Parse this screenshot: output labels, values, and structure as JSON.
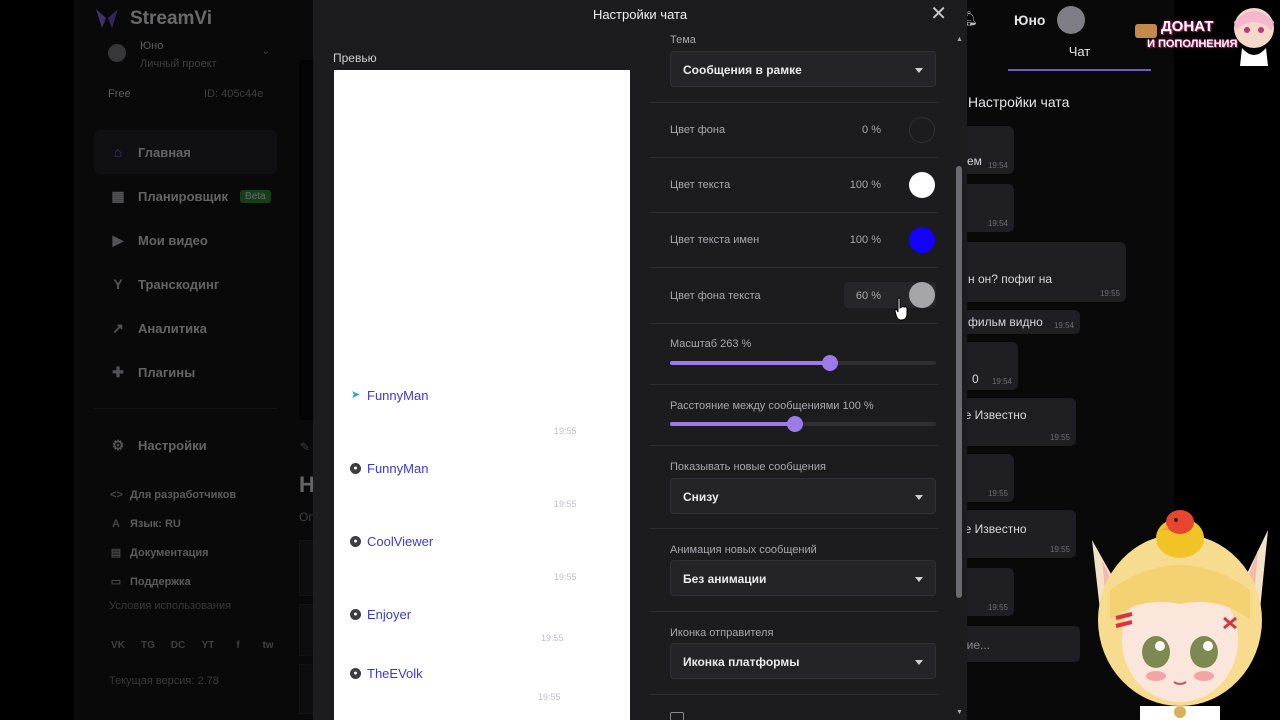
{
  "app": {
    "logo_text": "StreamVi",
    "project_name": "Юно",
    "project_sub": "Личный проект",
    "plan": "Free",
    "plan_id": "ID: 405c44e",
    "nav": [
      {
        "label": "Главная",
        "icon": "home-icon",
        "glyph": "⌂",
        "active": true
      },
      {
        "label": "Планировщик",
        "icon": "calendar-icon",
        "glyph": "▦",
        "badge": "Beta"
      },
      {
        "label": "Мои видео",
        "icon": "video-icon",
        "glyph": "▶"
      },
      {
        "label": "Транскодинг",
        "icon": "transcode-icon",
        "glyph": "Y"
      },
      {
        "label": "Аналитика",
        "icon": "analytics-icon",
        "glyph": "↗"
      },
      {
        "label": "Плагины",
        "icon": "puzzle-icon",
        "glyph": "✚"
      }
    ],
    "settings_label": "Настройки",
    "sublinks": [
      {
        "label": "Для разработчиков",
        "glyph": "<>"
      },
      {
        "label": "Язык: RU",
        "glyph": "A"
      },
      {
        "label": "Документация",
        "glyph": "▤"
      },
      {
        "label": "Поддержка",
        "glyph": "▭"
      }
    ],
    "terms": "Условия использования",
    "socials": [
      "VK",
      "TG",
      "DC",
      "YT",
      "f",
      "tw"
    ],
    "version": "Текущая версия: 2.78",
    "main_heading": "Н",
    "main_sub": "Оп",
    "user_name": "Юно",
    "chat_tab": "Чат",
    "chat_title": "Настройки чата",
    "chat_bubbles": [
      {
        "text": "ем",
        "time": "19:54"
      },
      {
        "text": "",
        "time": "19:54"
      },
      {
        "text": "н он? пофиг на",
        "time": "19:55"
      },
      {
        "text": "е фильм видно",
        "time": "19:54"
      },
      {
        "text": "0",
        "time": "19:54"
      },
      {
        "text": "ое Известно",
        "time": "19:55"
      },
      {
        "text": "",
        "time": "19:55"
      },
      {
        "text": "ое Известно",
        "time": "19:55"
      },
      {
        "text": "",
        "time": "19:55"
      },
      {
        "text": "ние...",
        "time": ""
      }
    ]
  },
  "modal": {
    "title": "Настройки чата",
    "preview_label": "Превью",
    "preview_messages": [
      {
        "name": "FunnyMan",
        "platform": "telegram",
        "time": "19:55"
      },
      {
        "name": "FunnyMan",
        "platform": "streamvi",
        "time": "19:55"
      },
      {
        "name": "CoolViewer",
        "platform": "streamvi",
        "time": "19:55"
      },
      {
        "name": "Enjoyer",
        "platform": "streamvi",
        "time": "19:55"
      },
      {
        "name": "TheEVolk",
        "platform": "streamvi",
        "time": "19:55"
      }
    ],
    "theme": {
      "label": "Тема",
      "value": "Сообщения в рамке"
    },
    "colors": [
      {
        "label": "Цвет фона",
        "percent": "0 %",
        "color": "#1c1c1f"
      },
      {
        "label": "Цвет текста",
        "percent": "100 %",
        "color": "#ffffff"
      },
      {
        "label": "Цвет текста имен",
        "percent": "100 %",
        "color": "#1400ff"
      },
      {
        "label": "Цвет фона текста",
        "percent": "60 %",
        "color": "#a6a6aa"
      }
    ],
    "scale": {
      "label": "Масштаб 263 %",
      "fraction": 0.6
    },
    "spacing": {
      "label": "Расстояние между сообщениями 100 %",
      "fraction": 0.47
    },
    "show_new": {
      "label": "Показывать новые сообщения",
      "value": "Снизу"
    },
    "animation": {
      "label": "Анимация новых сообщений",
      "value": "Без анимации"
    },
    "sender_icon": {
      "label": "Иконка отправителя",
      "value": "Иконка платформы"
    }
  },
  "overlay": {
    "donate_line1": "ДОНАТ",
    "donate_line2": "И ПОПОЛНЕНИЯ"
  },
  "colors": {
    "accent": "#9a7be8",
    "modal_bg": "#1c1c1f",
    "preview_name": "#3a3ad8"
  }
}
